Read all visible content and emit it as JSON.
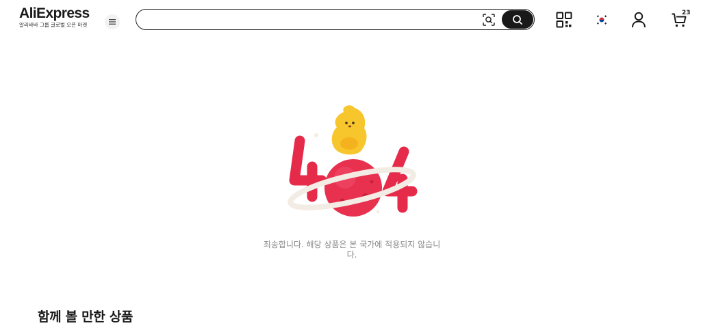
{
  "header": {
    "logo_text": "AliExpress",
    "logo_subtitle": "알리바바 그룹 글로벌 오픈 마켓",
    "search": {
      "value": "",
      "placeholder": ""
    },
    "icons": {
      "menu": "hamburger-menu-icon",
      "camera": "camera-search-icon",
      "search": "search-icon",
      "qr": "qr-code-icon",
      "flag": "korea-flag-icon",
      "account": "user-icon",
      "cart": "cart-icon"
    },
    "cart_count": "23"
  },
  "error": {
    "illustration": "404-illustration",
    "message": "죄송합니다. 해당 상품은 본 국가에 적용되지 않습니다."
  },
  "recommendations": {
    "title": "함께 볼 만한 상품"
  },
  "colors": {
    "brand_dark": "#191919",
    "error_red": "#e8304f",
    "mascot_yellow": "#f7c62d",
    "muted_text": "#8a8a8a"
  }
}
